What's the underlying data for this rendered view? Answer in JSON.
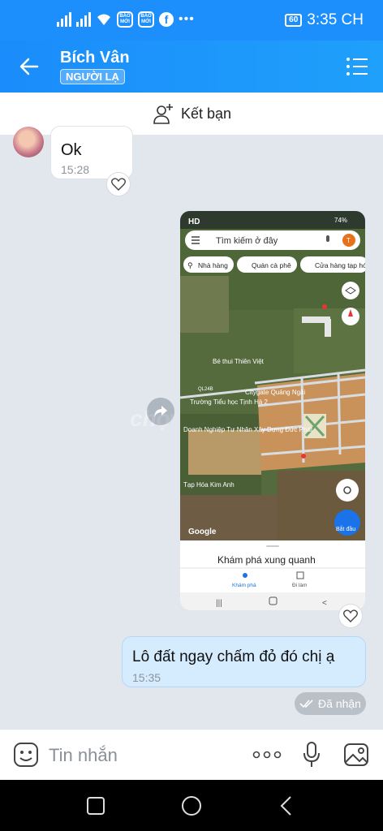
{
  "status_bar": {
    "baomoi_label": "BÁO MỚI",
    "dots": "•••",
    "battery": "60",
    "time": "3:35 CH"
  },
  "header": {
    "name": "Bích Vân",
    "badge": "NGƯỜI LẠ"
  },
  "add_friend": {
    "label": "Kết bạn"
  },
  "messages": [
    {
      "text": "Ok",
      "time": "15:28"
    },
    {
      "text": "Lô đất ngay chấm đỏ đó chị ạ",
      "time": "15:35"
    }
  ],
  "received_label": "Đã nhận",
  "watermark": "chợ",
  "shared_screenshot": {
    "status": "74%",
    "hd": "HD",
    "search_placeholder": "Tìm kiếm ở đây",
    "avatar_letter": "T",
    "chips": [
      "Nhà hàng",
      "Quán cà phê",
      "Cửa hàng tạp hóa"
    ],
    "places": [
      "Bé thui Thiên Việt",
      "Citygate Quảng Ngãi",
      "Trường Tiểu học Tịnh Hà 2",
      "Doanh Nghiệp Tư Nhân Xây Dựng Đức Phát",
      "Tạp Hóa Kim Anh"
    ],
    "road_label": "QL24B",
    "google": "Google",
    "start_label": "Bắt đầu",
    "explore_title": "Khám phá xung quanh",
    "tabs": [
      "Khám phá",
      "Đi làm"
    ]
  },
  "composer": {
    "placeholder": "Tin nhắn"
  },
  "colors": {
    "brand": "#1c8ffc",
    "outgoing_bubble": "#d5ecff",
    "background": "#e2e7ee"
  }
}
